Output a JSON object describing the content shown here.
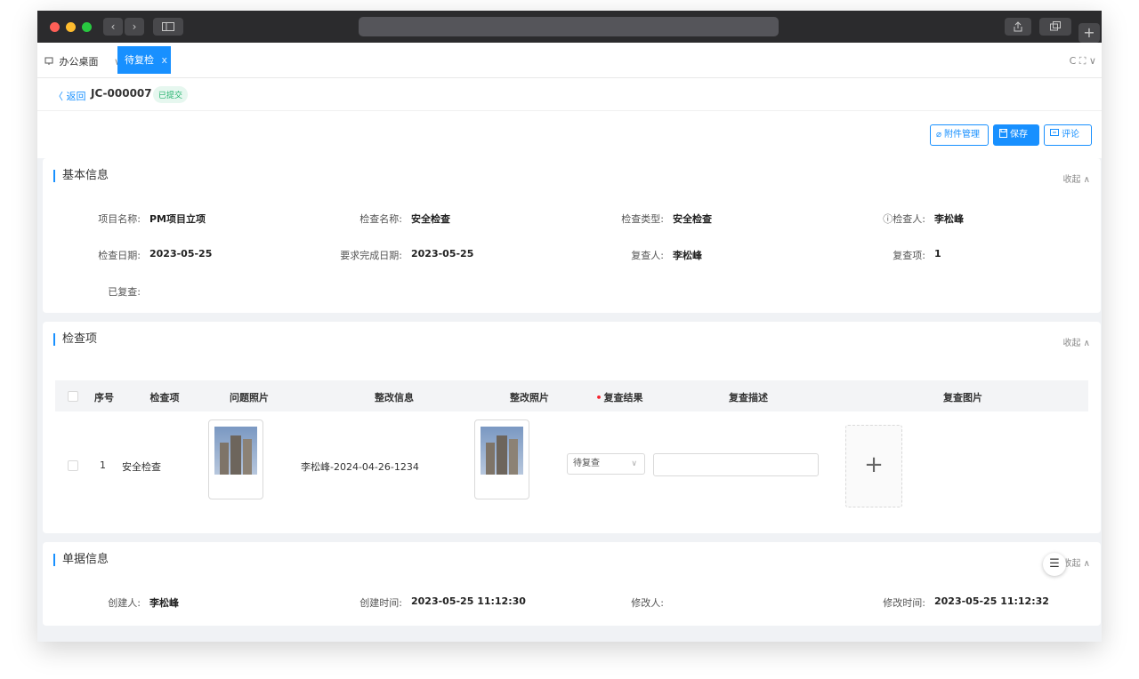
{
  "browser": {
    "nav_back": "‹",
    "nav_forward": "›",
    "new_tab": "+"
  },
  "tabs": {
    "home_label": "办公桌面",
    "active_label": "待复检",
    "close_glyph": "x",
    "tools": "C ⛶ ∨"
  },
  "header": {
    "back_label": "〈 返回",
    "code": "JC-000007",
    "status": "已提交",
    "attach_label": "附件管理",
    "save_label": "保存",
    "comment_label": "评论"
  },
  "basic_info": {
    "title": "基本信息",
    "collapse_label": "收起 ∧",
    "fields": [
      {
        "label": "项目名称:",
        "value": "PM项目立项"
      },
      {
        "label": "检查名称:",
        "value": "安全检查"
      },
      {
        "label": "检查类型:",
        "value": "安全检查"
      },
      {
        "label": "检查人:",
        "value": "李松峰"
      },
      {
        "label": "检查日期:",
        "value": "2023-05-25"
      },
      {
        "label": "要求完成日期:",
        "value": "2023-05-25"
      },
      {
        "label": "复查人:",
        "value": "李松峰"
      },
      {
        "label": "复查项:",
        "value": "1"
      },
      {
        "label": "已复查:",
        "value": ""
      }
    ]
  },
  "check_items": {
    "title": "检查项",
    "collapse_label": "收起 ∧",
    "columns": [
      "序号",
      "检查项",
      "问题照片",
      "整改信息",
      "整改照片",
      "复查结果",
      "复查描述",
      "复查图片"
    ],
    "required_mark": "•",
    "rows": [
      {
        "index": "1",
        "item": "安全检查",
        "rectify_info": "李松峰-2024-04-26-1234",
        "result": "待复查",
        "description": ""
      }
    ],
    "upload_glyph": "+"
  },
  "doc_info": {
    "title": "单据信息",
    "collapse_label": "收起 ∧",
    "fields": [
      {
        "label": "创建人:",
        "value": "李松峰"
      },
      {
        "label": "创建时间:",
        "value": "2023-05-25 11:12:30"
      },
      {
        "label": "修改人:",
        "value": ""
      },
      {
        "label": "修改时间:",
        "value": "2023-05-25 11:12:32"
      }
    ]
  },
  "float_button_glyph": "☰"
}
